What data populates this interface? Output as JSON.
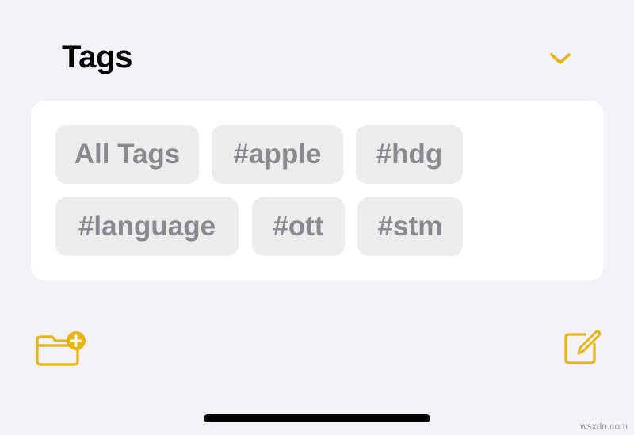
{
  "header": {
    "title": "Tags",
    "collapse_icon": "chevron-down-icon"
  },
  "tags": [
    {
      "label": "All Tags"
    },
    {
      "label": "#apple"
    },
    {
      "label": "#hdg"
    },
    {
      "label": "#language"
    },
    {
      "label": "#ott"
    },
    {
      "label": "#stm"
    }
  ],
  "toolbar": {
    "new_folder_icon": "folder-plus-icon",
    "compose_icon": "compose-icon"
  },
  "colors": {
    "accent": "#e6b412",
    "background": "#f2f2f7",
    "card": "#ffffff",
    "chip": "#ececec",
    "chip_text": "#8a8a8e"
  },
  "watermark": "wsxdn.com"
}
